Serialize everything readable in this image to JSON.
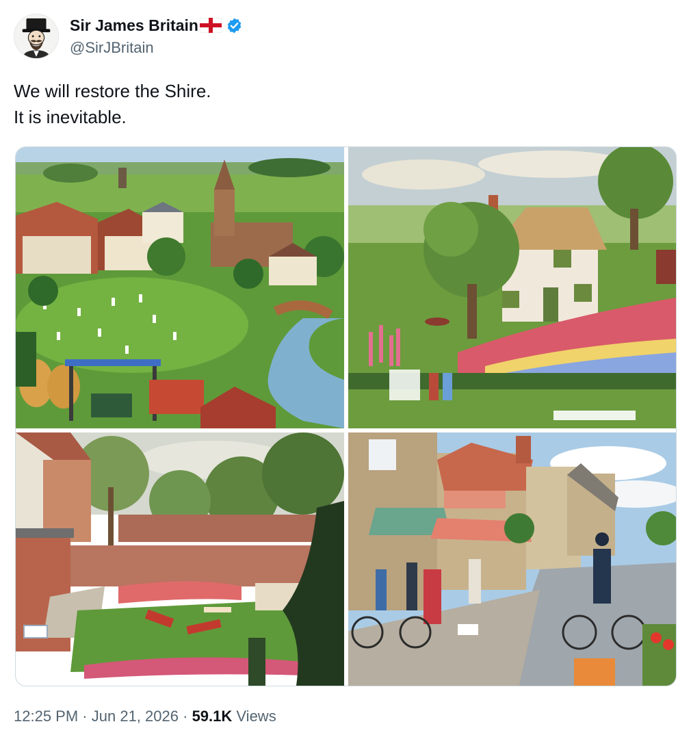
{
  "author": {
    "display_name": "Sir James Britain",
    "flag_icon": "england-flag-icon",
    "verified_icon": "verified-badge-icon",
    "handle": "@SirJBritain",
    "avatar_icon": "top-hat-gentleman-avatar"
  },
  "tweet": {
    "lines": [
      "We will restore the Shire.",
      "It is inevitable."
    ]
  },
  "media": {
    "images": [
      {
        "name": "village-cricket-green-painting"
      },
      {
        "name": "thatched-cottage-garden-painting"
      },
      {
        "name": "walled-garden-painting"
      },
      {
        "name": "village-high-street-painting"
      }
    ]
  },
  "meta": {
    "time": "12:25 PM",
    "separator": "·",
    "date": "Jun 21, 2026",
    "views_count": "59.1K",
    "views_label": "Views"
  },
  "colors": {
    "text": "#0f1419",
    "secondary": "#536471",
    "verified_blue": "#1d9bf0",
    "flag_red": "#ce1124"
  }
}
